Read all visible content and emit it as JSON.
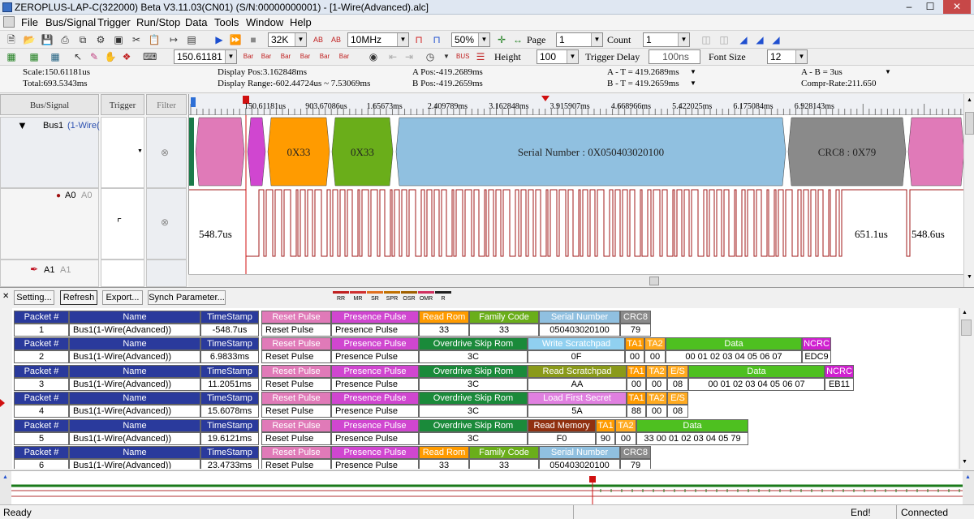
{
  "window": {
    "title": "ZEROPLUS-LAP-C(322000) Beta V3.11.03(CN01) (S/N:00000000001) - [1-Wire(Advanced).alc]"
  },
  "menu": [
    "File",
    "Bus/Signal",
    "Trigger",
    "Run/Stop",
    "Data",
    "Tools",
    "Window",
    "Help"
  ],
  "toolbar1": {
    "memory": "32K",
    "clock": "10MHz",
    "zoom": "50%",
    "page_label": "Page",
    "page_value": "1",
    "count_label": "Count",
    "count_value": "1"
  },
  "toolbar2": {
    "position": "150.61181",
    "height_label": "Height",
    "height_value": "100",
    "trigger_delay_label": "Trigger Delay",
    "trigger_delay_value": "100ns",
    "font_size_label": "Font Size",
    "font_size_value": "12"
  },
  "info": {
    "scale": "Scale:150.61181us",
    "total": "Total:693.5343ms",
    "display_pos": "Display Pos:3.162848ms",
    "display_range": "Display Range:-602.44724us ~ 7.53069ms",
    "a_pos": "A Pos:-419.2689ms",
    "b_pos": "B Pos:-419.2659ms",
    "a_t": "A - T = 419.2689ms",
    "b_t": "B - T = 419.2659ms",
    "a_b": "A - B = 3us",
    "compr": "Compr-Rate:211.650"
  },
  "columns": {
    "bus_signal": "Bus/Signal",
    "trigger": "Trigger",
    "filter": "Filter"
  },
  "signals": [
    {
      "name": "Bus1",
      "desc": "(1-Wire(A"
    },
    {
      "name": "A0",
      "alias": "A0"
    },
    {
      "name": "A1",
      "alias": "A1"
    }
  ],
  "ruler": [
    "150.61181us",
    "903.67086us",
    "1.65673ms",
    "2.409789ms",
    "3.162848ms",
    "3.915907ms",
    "4.668966ms",
    "5.422025ms",
    "6.175084ms",
    "6.928143ms"
  ],
  "bus_blocks": [
    {
      "label": "",
      "color": "#e07ab8"
    },
    {
      "label": "",
      "color": "#d046d0"
    },
    {
      "label": "0X33",
      "color": "#ff9b00"
    },
    {
      "label": "0X33",
      "color": "#6aae1a"
    },
    {
      "label": "Serial Number : 0X050403020100",
      "color": "#90c0e0"
    },
    {
      "label": "CRC8 : 0X79",
      "color": "#8a8a8a"
    },
    {
      "label": "",
      "color": "#e07ab8"
    }
  ],
  "wave_labels": {
    "left": "548.7us",
    "right1": "651.1us",
    "right2": "548.6us"
  },
  "buttons": [
    "Setting...",
    "Refresh",
    "Export...",
    "Synch Parameter..."
  ],
  "legend": [
    "RR",
    "MR",
    "SR",
    "SPR",
    "OSR",
    "OMR",
    "R"
  ],
  "packets": [
    {
      "cells": [
        [
          "Packet #",
          "1"
        ],
        [
          "Name",
          "Bus1(1-Wire(Advanced))"
        ],
        [
          "TimeStamp",
          "-548.7us"
        ],
        [
          "Reset Pulse",
          "Reset Pulse"
        ],
        [
          "Presence Pulse",
          "Presence Pulse"
        ],
        [
          "Read Rom",
          "33"
        ],
        [
          "Family Code",
          "33"
        ],
        [
          "Serial Number",
          "050403020100"
        ],
        [
          "CRC8",
          "79"
        ]
      ]
    },
    {
      "cells": [
        [
          "Packet #",
          "2"
        ],
        [
          "Name",
          "Bus1(1-Wire(Advanced))"
        ],
        [
          "TimeStamp",
          "6.9833ms"
        ],
        [
          "Reset Pulse",
          "Reset Pulse"
        ],
        [
          "Presence Pulse",
          "Presence Pulse"
        ],
        [
          "Overdrive Skip Rom",
          "3C"
        ],
        [
          "Write Scratchpad",
          "0F"
        ],
        [
          "TA1",
          "00"
        ],
        [
          "TA2",
          "00"
        ],
        [
          "Data",
          "00  01  02  03  04  05  06  07"
        ],
        [
          "NCRC",
          "EDC9"
        ]
      ]
    },
    {
      "cells": [
        [
          "Packet #",
          "3"
        ],
        [
          "Name",
          "Bus1(1-Wire(Advanced))"
        ],
        [
          "TimeStamp",
          "11.2051ms"
        ],
        [
          "Reset Pulse",
          "Reset Pulse"
        ],
        [
          "Presence Pulse",
          "Presence Pulse"
        ],
        [
          "Overdrive Skip Rom",
          "3C"
        ],
        [
          "Read Scratchpad",
          "AA"
        ],
        [
          "TA1",
          "00"
        ],
        [
          "TA2",
          "00"
        ],
        [
          "E/S",
          "08"
        ],
        [
          "Data",
          "00  01  02  03  04  05  06  07"
        ],
        [
          "NCRC",
          "EB11"
        ]
      ]
    },
    {
      "cells": [
        [
          "Packet #",
          "4"
        ],
        [
          "Name",
          "Bus1(1-Wire(Advanced))"
        ],
        [
          "TimeStamp",
          "15.6078ms"
        ],
        [
          "Reset Pulse",
          "Reset Pulse"
        ],
        [
          "Presence Pulse",
          "Presence Pulse"
        ],
        [
          "Overdrive Skip Rom",
          "3C"
        ],
        [
          "Load First Secret",
          "5A"
        ],
        [
          "TA1",
          "88"
        ],
        [
          "TA2",
          "00"
        ],
        [
          "E/S",
          "08"
        ]
      ]
    },
    {
      "cells": [
        [
          "Packet #",
          "5"
        ],
        [
          "Name",
          "Bus1(1-Wire(Advanced))"
        ],
        [
          "TimeStamp",
          "19.6121ms"
        ],
        [
          "Reset Pulse",
          "Reset Pulse"
        ],
        [
          "Presence Pulse",
          "Presence Pulse"
        ],
        [
          "Overdrive Skip Rom",
          "3C"
        ],
        [
          "Read Memory",
          "F0"
        ],
        [
          "TA1",
          "90"
        ],
        [
          "TA2",
          "00"
        ],
        [
          "Data",
          "33  00  01  02  03  04  05  79"
        ]
      ]
    },
    {
      "cells": [
        [
          "Packet #",
          "6"
        ],
        [
          "Name",
          "Bus1(1-Wire(Advanced))"
        ],
        [
          "TimeStamp",
          "23.4733ms"
        ],
        [
          "Reset Pulse",
          "Reset Pulse"
        ],
        [
          "Presence Pulse",
          "Presence Pulse"
        ],
        [
          "Read Rom",
          "33"
        ],
        [
          "Family Code",
          "33"
        ],
        [
          "Serial Number",
          "050403020100"
        ],
        [
          "CRC8",
          "79"
        ]
      ]
    }
  ],
  "status": {
    "ready": "Ready",
    "end": "End!",
    "connected": "Connected"
  }
}
